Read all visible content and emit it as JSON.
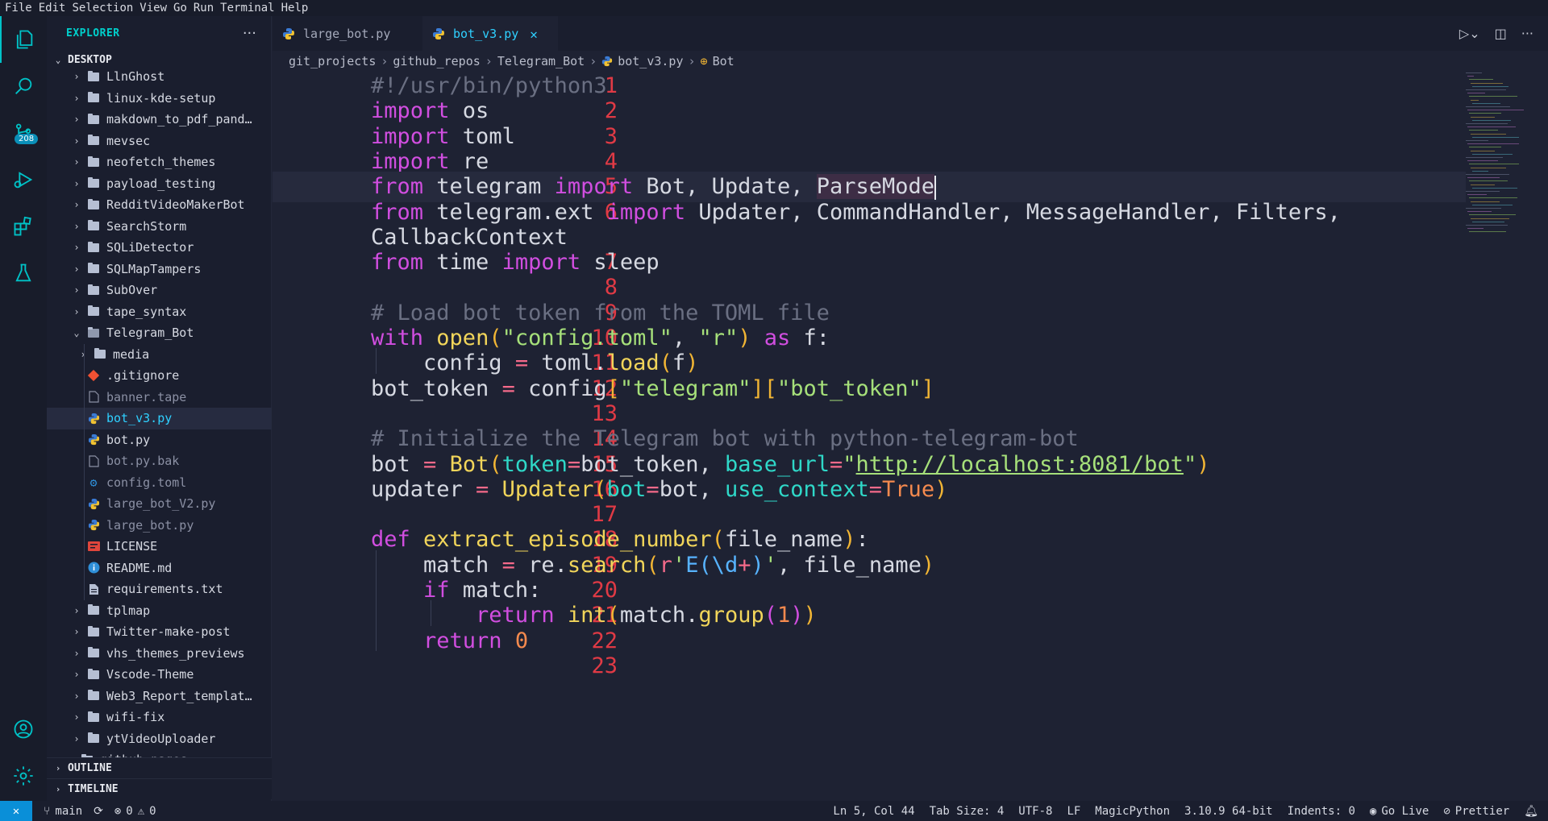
{
  "menu": [
    "File",
    "Edit",
    "Selection",
    "View",
    "Go",
    "Run",
    "Terminal",
    "Help"
  ],
  "activity": {
    "scm_badge": "208"
  },
  "sidebar": {
    "title": "EXPLORER",
    "more": "···",
    "section": "DESKTOP",
    "items": [
      {
        "label": "LlnGhost",
        "type": "folder",
        "level": 1
      },
      {
        "label": "linux-kde-setup",
        "type": "folder",
        "level": 1
      },
      {
        "label": "makdown_to_pdf_pand…",
        "type": "folder",
        "level": 1
      },
      {
        "label": "mevsec",
        "type": "folder",
        "level": 1
      },
      {
        "label": "neofetch_themes",
        "type": "folder",
        "level": 1
      },
      {
        "label": "payload_testing",
        "type": "folder",
        "level": 1
      },
      {
        "label": "RedditVideoMakerBot",
        "type": "folder",
        "level": 1
      },
      {
        "label": "SearchStorm",
        "type": "folder",
        "level": 1
      },
      {
        "label": "SQLiDetector",
        "type": "folder",
        "level": 1
      },
      {
        "label": "SQLMapTampers",
        "type": "folder",
        "level": 1
      },
      {
        "label": "SubOver",
        "type": "folder",
        "level": 1
      },
      {
        "label": "tape_syntax",
        "type": "folder",
        "level": 1
      },
      {
        "label": "Telegram_Bot",
        "type": "folder-open",
        "level": 1
      },
      {
        "label": "media",
        "type": "folder",
        "level": 2
      },
      {
        "label": ".gitignore",
        "type": "git",
        "level": 2
      },
      {
        "label": "banner.tape",
        "type": "file",
        "level": 2,
        "dim": true
      },
      {
        "label": "bot_v3.py",
        "type": "python",
        "level": 2,
        "active": true
      },
      {
        "label": "bot.py",
        "type": "python",
        "level": 2
      },
      {
        "label": "bot.py.bak",
        "type": "file",
        "level": 2,
        "dim": true
      },
      {
        "label": "config.toml",
        "type": "gear",
        "level": 2,
        "dim": true
      },
      {
        "label": "large_bot_V2.py",
        "type": "python",
        "level": 2,
        "dim": true
      },
      {
        "label": "large_bot.py",
        "type": "python",
        "level": 2,
        "dim": true
      },
      {
        "label": "LICENSE",
        "type": "license",
        "level": 2
      },
      {
        "label": "README.md",
        "type": "info",
        "level": 2
      },
      {
        "label": "requirements.txt",
        "type": "txt",
        "level": 2
      },
      {
        "label": "tplmap",
        "type": "folder",
        "level": 1
      },
      {
        "label": "Twitter-make-post",
        "type": "folder",
        "level": 1
      },
      {
        "label": "vhs_themes_previews",
        "type": "folder",
        "level": 1
      },
      {
        "label": "Vscode-Theme",
        "type": "folder",
        "level": 1
      },
      {
        "label": "Web3_Report_templat…",
        "type": "folder",
        "level": 1
      },
      {
        "label": "wifi-fix",
        "type": "folder",
        "level": 1
      },
      {
        "label": "ytVideoUploader",
        "type": "folder",
        "level": 1
      },
      {
        "label": "github-pages",
        "type": "folder",
        "level": 0
      }
    ],
    "outline": "OUTLINE",
    "timeline": "TIMELINE"
  },
  "tabs": [
    {
      "label": "large_bot.py",
      "active": false
    },
    {
      "label": "bot_v3.py",
      "active": true,
      "close": "✕"
    }
  ],
  "breadcrumb": [
    "git_projects",
    "github_repos",
    "Telegram_Bot",
    "bot_v3.py",
    "Bot"
  ],
  "editor": {
    "line_numbers": [
      "1",
      "2",
      "3",
      "4",
      "5",
      "6",
      "",
      "7",
      "8",
      "9",
      "10",
      "11",
      "12",
      "13",
      "14",
      "15",
      "16",
      "17",
      "18",
      "19",
      "20",
      "21",
      "22",
      "23"
    ],
    "lines": [
      "#!/usr/bin/python3",
      "import os",
      "import toml",
      "import re",
      "from telegram import Bot, Update, ParseMode",
      "from telegram.ext import Updater, CommandHandler, MessageHandler, Filters,",
      "CallbackContext",
      "from time import sleep",
      "",
      "# Load bot token from the TOML file",
      "with open(\"config.toml\", \"r\") as f:",
      "    config = toml.load(f)",
      "bot_token = config[\"telegram\"][\"bot_token\"]",
      "",
      "# Initialize the Telegram bot with python-telegram-bot",
      "bot = Bot(token=bot_token, base_url=\"http://localhost:8081/bot\")",
      "updater = Updater(bot=bot, use_context=True)",
      "",
      "def extract_episode_number(file_name):",
      "    match = re.search(r'E(\\d+)', file_name)",
      "    if match:",
      "        return int(match.group(1))",
      "    return 0",
      ""
    ]
  },
  "status": {
    "branch": "main",
    "errors": "0",
    "warnings": "0",
    "position": "Ln 5, Col 44",
    "tab_size": "Tab Size: 4",
    "encoding": "UTF-8",
    "eol": "LF",
    "language": "MagicPython",
    "interpreter": "3.10.9 64-bit",
    "indents": "Indents: 0",
    "go_live": "Go Live",
    "prettier": "Prettier"
  },
  "colors": {
    "accent": "#00c2c7",
    "keyword": "#d14ee0",
    "string": "#a6e07a",
    "function": "#f1d55a",
    "line_number": "#e03a45"
  }
}
